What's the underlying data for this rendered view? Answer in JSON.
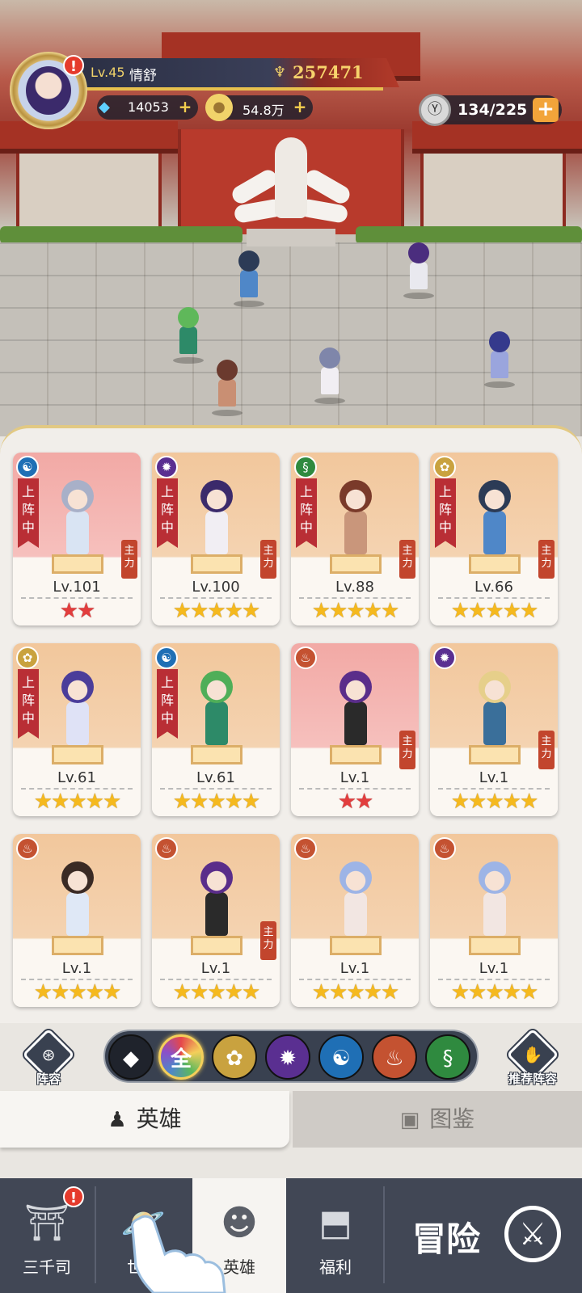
{
  "player": {
    "level": "Lv.45",
    "name": "情舒",
    "power": "257471",
    "alert": "!"
  },
  "currencies": {
    "diamonds": "14053",
    "gold": "54.8万",
    "plus": "+"
  },
  "stamina": {
    "value": "134/225",
    "plus": "+"
  },
  "heroes": [
    {
      "level": "Lv.101",
      "stars": "★★",
      "star_color": "red",
      "deployed": true,
      "main": true,
      "element": "water",
      "bg": "red"
    },
    {
      "level": "Lv.100",
      "stars": "★★★★★",
      "star_color": "gold",
      "deployed": true,
      "main": true,
      "element": "dark",
      "bg": "orange"
    },
    {
      "level": "Lv.88",
      "stars": "★★★★★",
      "star_color": "gold",
      "deployed": true,
      "main": true,
      "element": "nature",
      "bg": "orange"
    },
    {
      "level": "Lv.66",
      "stars": "★★★★★",
      "star_color": "gold",
      "deployed": true,
      "main": true,
      "element": "holy",
      "bg": "orange"
    },
    {
      "level": "Lv.61",
      "stars": "★★★★★",
      "star_color": "gold",
      "deployed": true,
      "main": false,
      "element": "holy",
      "bg": "orange"
    },
    {
      "level": "Lv.61",
      "stars": "★★★★★",
      "star_color": "gold",
      "deployed": true,
      "main": false,
      "element": "water",
      "bg": "orange"
    },
    {
      "level": "Lv.1",
      "stars": "★★",
      "star_color": "red",
      "deployed": false,
      "main": true,
      "element": "fire",
      "bg": "red"
    },
    {
      "level": "Lv.1",
      "stars": "★★★★★",
      "star_color": "gold",
      "deployed": false,
      "main": true,
      "element": "dark",
      "bg": "orange"
    },
    {
      "level": "Lv.1",
      "stars": "★★★★★",
      "star_color": "gold",
      "deployed": false,
      "main": false,
      "element": "fire",
      "bg": "orange"
    },
    {
      "level": "Lv.1",
      "stars": "★★★★★",
      "star_color": "gold",
      "deployed": false,
      "main": true,
      "element": "fire",
      "bg": "orange"
    },
    {
      "level": "Lv.1",
      "stars": "★★★★★",
      "star_color": "gold",
      "deployed": false,
      "main": false,
      "element": "fire",
      "bg": "orange"
    },
    {
      "level": "Lv.1",
      "stars": "★★★★★",
      "star_color": "gold",
      "deployed": false,
      "main": false,
      "element": "fire",
      "bg": "orange"
    }
  ],
  "labels": {
    "deployed": "上阵中",
    "main": "主力"
  },
  "filter": {
    "lineup_label": "阵容",
    "recommend_label": "推荐阵容",
    "all_label": "全",
    "buttons": [
      "rank-icon",
      "all",
      "holy-lotus-icon",
      "dark-flame-icon",
      "water-swirl-icon",
      "fire-meditate-icon",
      "nature-dna-icon"
    ]
  },
  "tabs": {
    "heroes": "英雄",
    "codex": "图鉴"
  },
  "nav": {
    "items": [
      "三千司",
      "世界",
      "英雄",
      "福利"
    ],
    "adventure": "冒险",
    "alert": "!"
  },
  "colors": {
    "deploy_ribbon": "#b92e35",
    "main_tag": "#c2452d",
    "star_gold": "#f5b91e",
    "star_red": "#e23d3d",
    "nav_bg": "#414755"
  }
}
